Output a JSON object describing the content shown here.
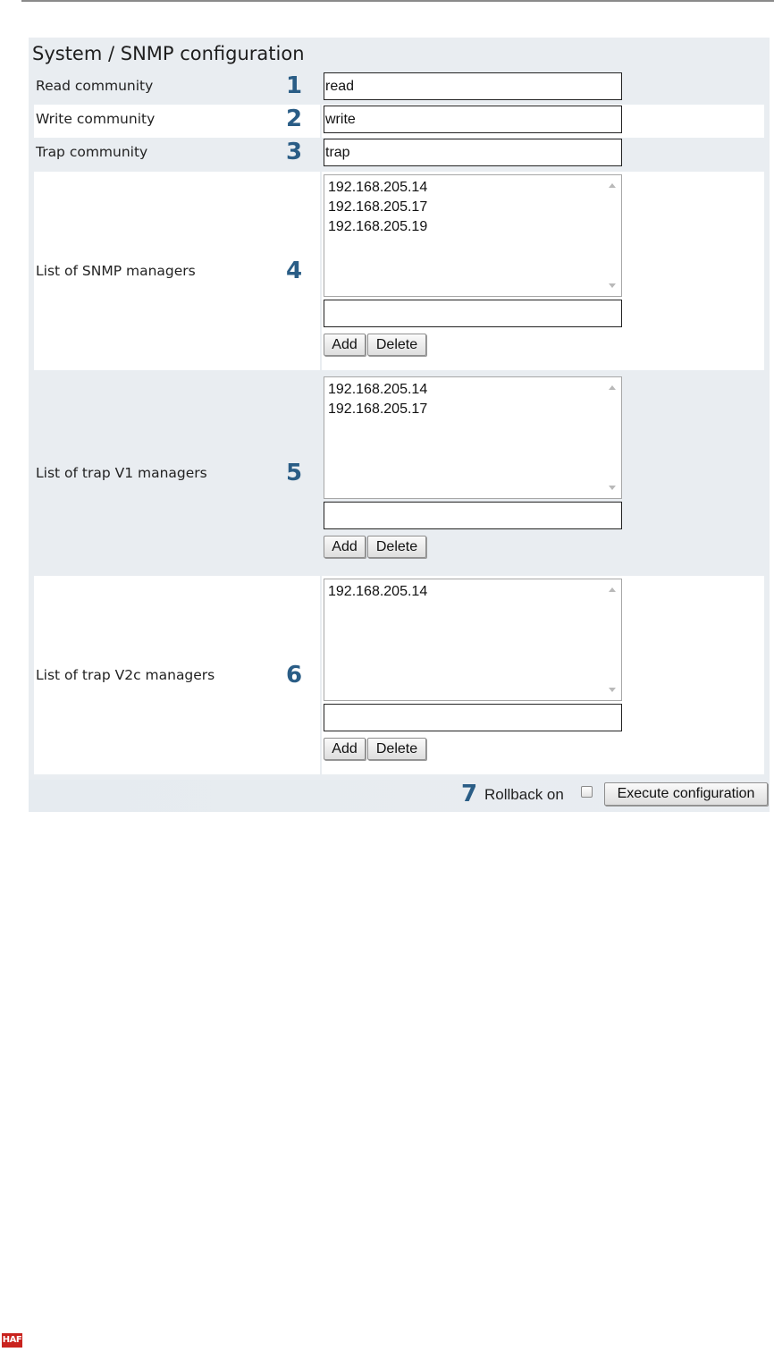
{
  "page": {
    "title": "System / SNMP configuration"
  },
  "fields": [
    {
      "label": "Read community",
      "number": "1",
      "value": "read"
    },
    {
      "label": "Write community",
      "number": "2",
      "value": "write"
    },
    {
      "label": "Trap community",
      "number": "3",
      "value": "trap"
    }
  ],
  "lists": [
    {
      "label": "List of SNMP managers",
      "number": "4",
      "items": [
        "192.168.205.14",
        "192.168.205.17",
        "192.168.205.19"
      ],
      "new_value": "",
      "add_label": "Add",
      "delete_label": "Delete"
    },
    {
      "label": "List of trap V1 managers",
      "number": "5",
      "items": [
        "192.168.205.14",
        "192.168.205.17"
      ],
      "new_value": "",
      "add_label": "Add",
      "delete_label": "Delete"
    },
    {
      "label": "List of trap V2c managers",
      "number": "6",
      "items": [
        "192.168.205.14"
      ],
      "new_value": "",
      "add_label": "Add",
      "delete_label": "Delete"
    }
  ],
  "footer": {
    "number": "7",
    "rollback_label": "Rollback on",
    "rollback_checked": false,
    "execute_label": "Execute configuration"
  },
  "logo": {
    "text": "HAF",
    "color": "#c9231e"
  },
  "colors": {
    "accent_number": "#2a5d86",
    "panel_bg": "#e9edf1"
  }
}
